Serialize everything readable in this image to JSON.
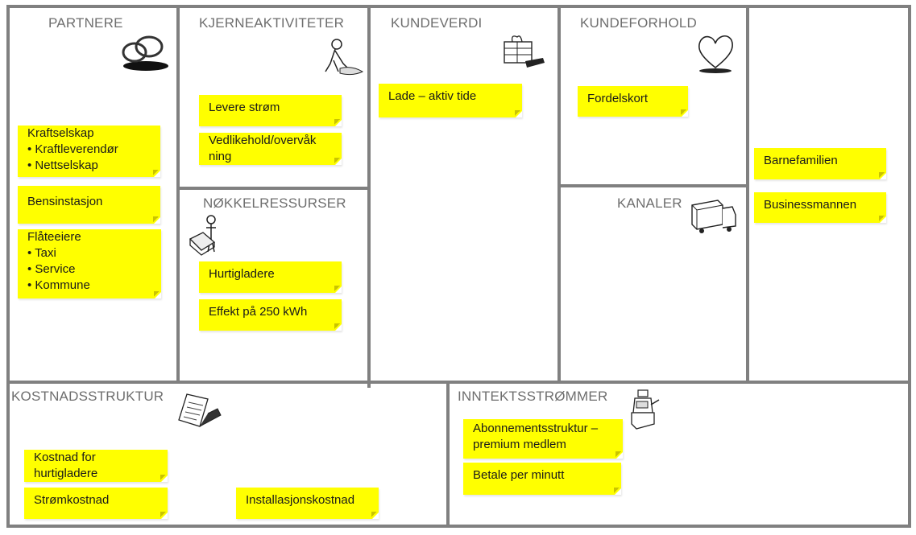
{
  "canvas": {
    "sections": {
      "partners": {
        "title": "PARTNERE",
        "icon": "rings-icon",
        "notes": [
          {
            "lines": [
              "Kraftselskap",
              "• Kraftleverendør",
              "• Nettselskap"
            ]
          },
          {
            "lines": [
              "Bensinstasjon"
            ]
          },
          {
            "lines": [
              "Flåteeiere",
              "• Taxi",
              "• Service",
              "• Kommune"
            ]
          }
        ]
      },
      "key_activities": {
        "title": "KJERNEAKTIVITETER",
        "icon": "worker-icon",
        "notes": [
          {
            "lines": [
              "Levere strøm"
            ]
          },
          {
            "lines": [
              "Vedlikehold/overvåk",
              "ning"
            ]
          }
        ]
      },
      "key_resources": {
        "title": "NØKKELRESSURSER",
        "icon": "person-with-machine-icon",
        "notes": [
          {
            "lines": [
              "Hurtigladere"
            ]
          },
          {
            "lines": [
              "Effekt på 250 kWh"
            ]
          }
        ]
      },
      "value_proposition": {
        "title": "KUNDEVERDI",
        "icon": "gift-icon",
        "notes": [
          {
            "lines": [
              "Lade – aktiv tide"
            ]
          }
        ]
      },
      "customer_relationships": {
        "title": "KUNDEFORHOLD",
        "icon": "heart-icon",
        "notes": [
          {
            "lines": [
              "Fordelskort"
            ]
          }
        ]
      },
      "channels": {
        "title": "KANALER",
        "icon": "truck-icon",
        "notes": []
      },
      "customer_segments": {
        "title": "",
        "notes": [
          {
            "lines": [
              "Barnefamilien"
            ]
          },
          {
            "lines": [
              "Businessmannen"
            ]
          }
        ]
      },
      "cost_structure": {
        "title": "KOSTNADSSTRUKTUR",
        "icon": "documents-icon",
        "notes": [
          {
            "lines": [
              "Kostnad for",
              "hurtigladere"
            ]
          },
          {
            "lines": [
              "Strømkostnad"
            ]
          },
          {
            "lines": [
              "Installasjonskostnad"
            ]
          }
        ]
      },
      "revenue_streams": {
        "title": "INNTEKTSSTRØMMER",
        "icon": "cash-register-icon",
        "notes": [
          {
            "lines": [
              "Abonnementsstruktur –",
              "premium medlem"
            ]
          },
          {
            "lines": [
              "Betale per minutt"
            ]
          }
        ]
      }
    },
    "colors": {
      "note": "#ffff00",
      "grid_line": "#808080",
      "title": "#6e6e6e"
    }
  }
}
